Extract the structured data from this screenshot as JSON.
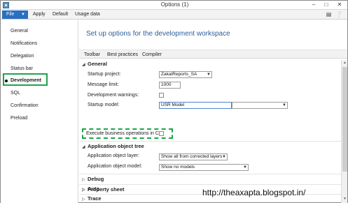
{
  "window": {
    "title": "Options (1)",
    "minimize_icon": "minimize-icon",
    "restore_icon": "restore-icon",
    "close_icon": "close-icon"
  },
  "menubar": {
    "file_label": "File",
    "items": [
      "Apply",
      "Default",
      "Usage data"
    ],
    "help_icon": "help-icon",
    "info_icon": "info-icon"
  },
  "sidebar": {
    "items": [
      {
        "label": "General"
      },
      {
        "label": "Notifications"
      },
      {
        "label": "Delegation"
      },
      {
        "label": "Status bar"
      },
      {
        "label": "Development",
        "active": true
      },
      {
        "label": "SQL"
      },
      {
        "label": "Confirmation"
      },
      {
        "label": "Preload"
      }
    ]
  },
  "main": {
    "title": "Set up options for the development workspace",
    "tabs": [
      "Toolbar",
      "Best practices",
      "Compiler"
    ]
  },
  "general": {
    "heading": "General",
    "startup_project_label": "Startup project:",
    "startup_project_value": "ZakatReports_SA",
    "message_limit_label": "Message limit:",
    "message_limit_value": "1000",
    "dev_warnings_label": "Development warnings:",
    "startup_model_label": "Startup model:",
    "startup_model_value": "USR Model",
    "execute_cil_label": "Execute business operations in CIL:"
  },
  "aot": {
    "heading": "Application object tree",
    "layer_label": "Application object layer:",
    "layer_value": "Show all from corrected layers",
    "model_label": "Application object model:",
    "model_value": "Show no models"
  },
  "collapsed_sections": [
    "Debug",
    "Auto",
    "Trace",
    "Property sheet"
  ],
  "watermark": "http://theaxapta.blogspot.in/",
  "colors": {
    "accent": "#2a6fc0",
    "title": "#2c5f9a",
    "highlight": "#1aa54a"
  }
}
